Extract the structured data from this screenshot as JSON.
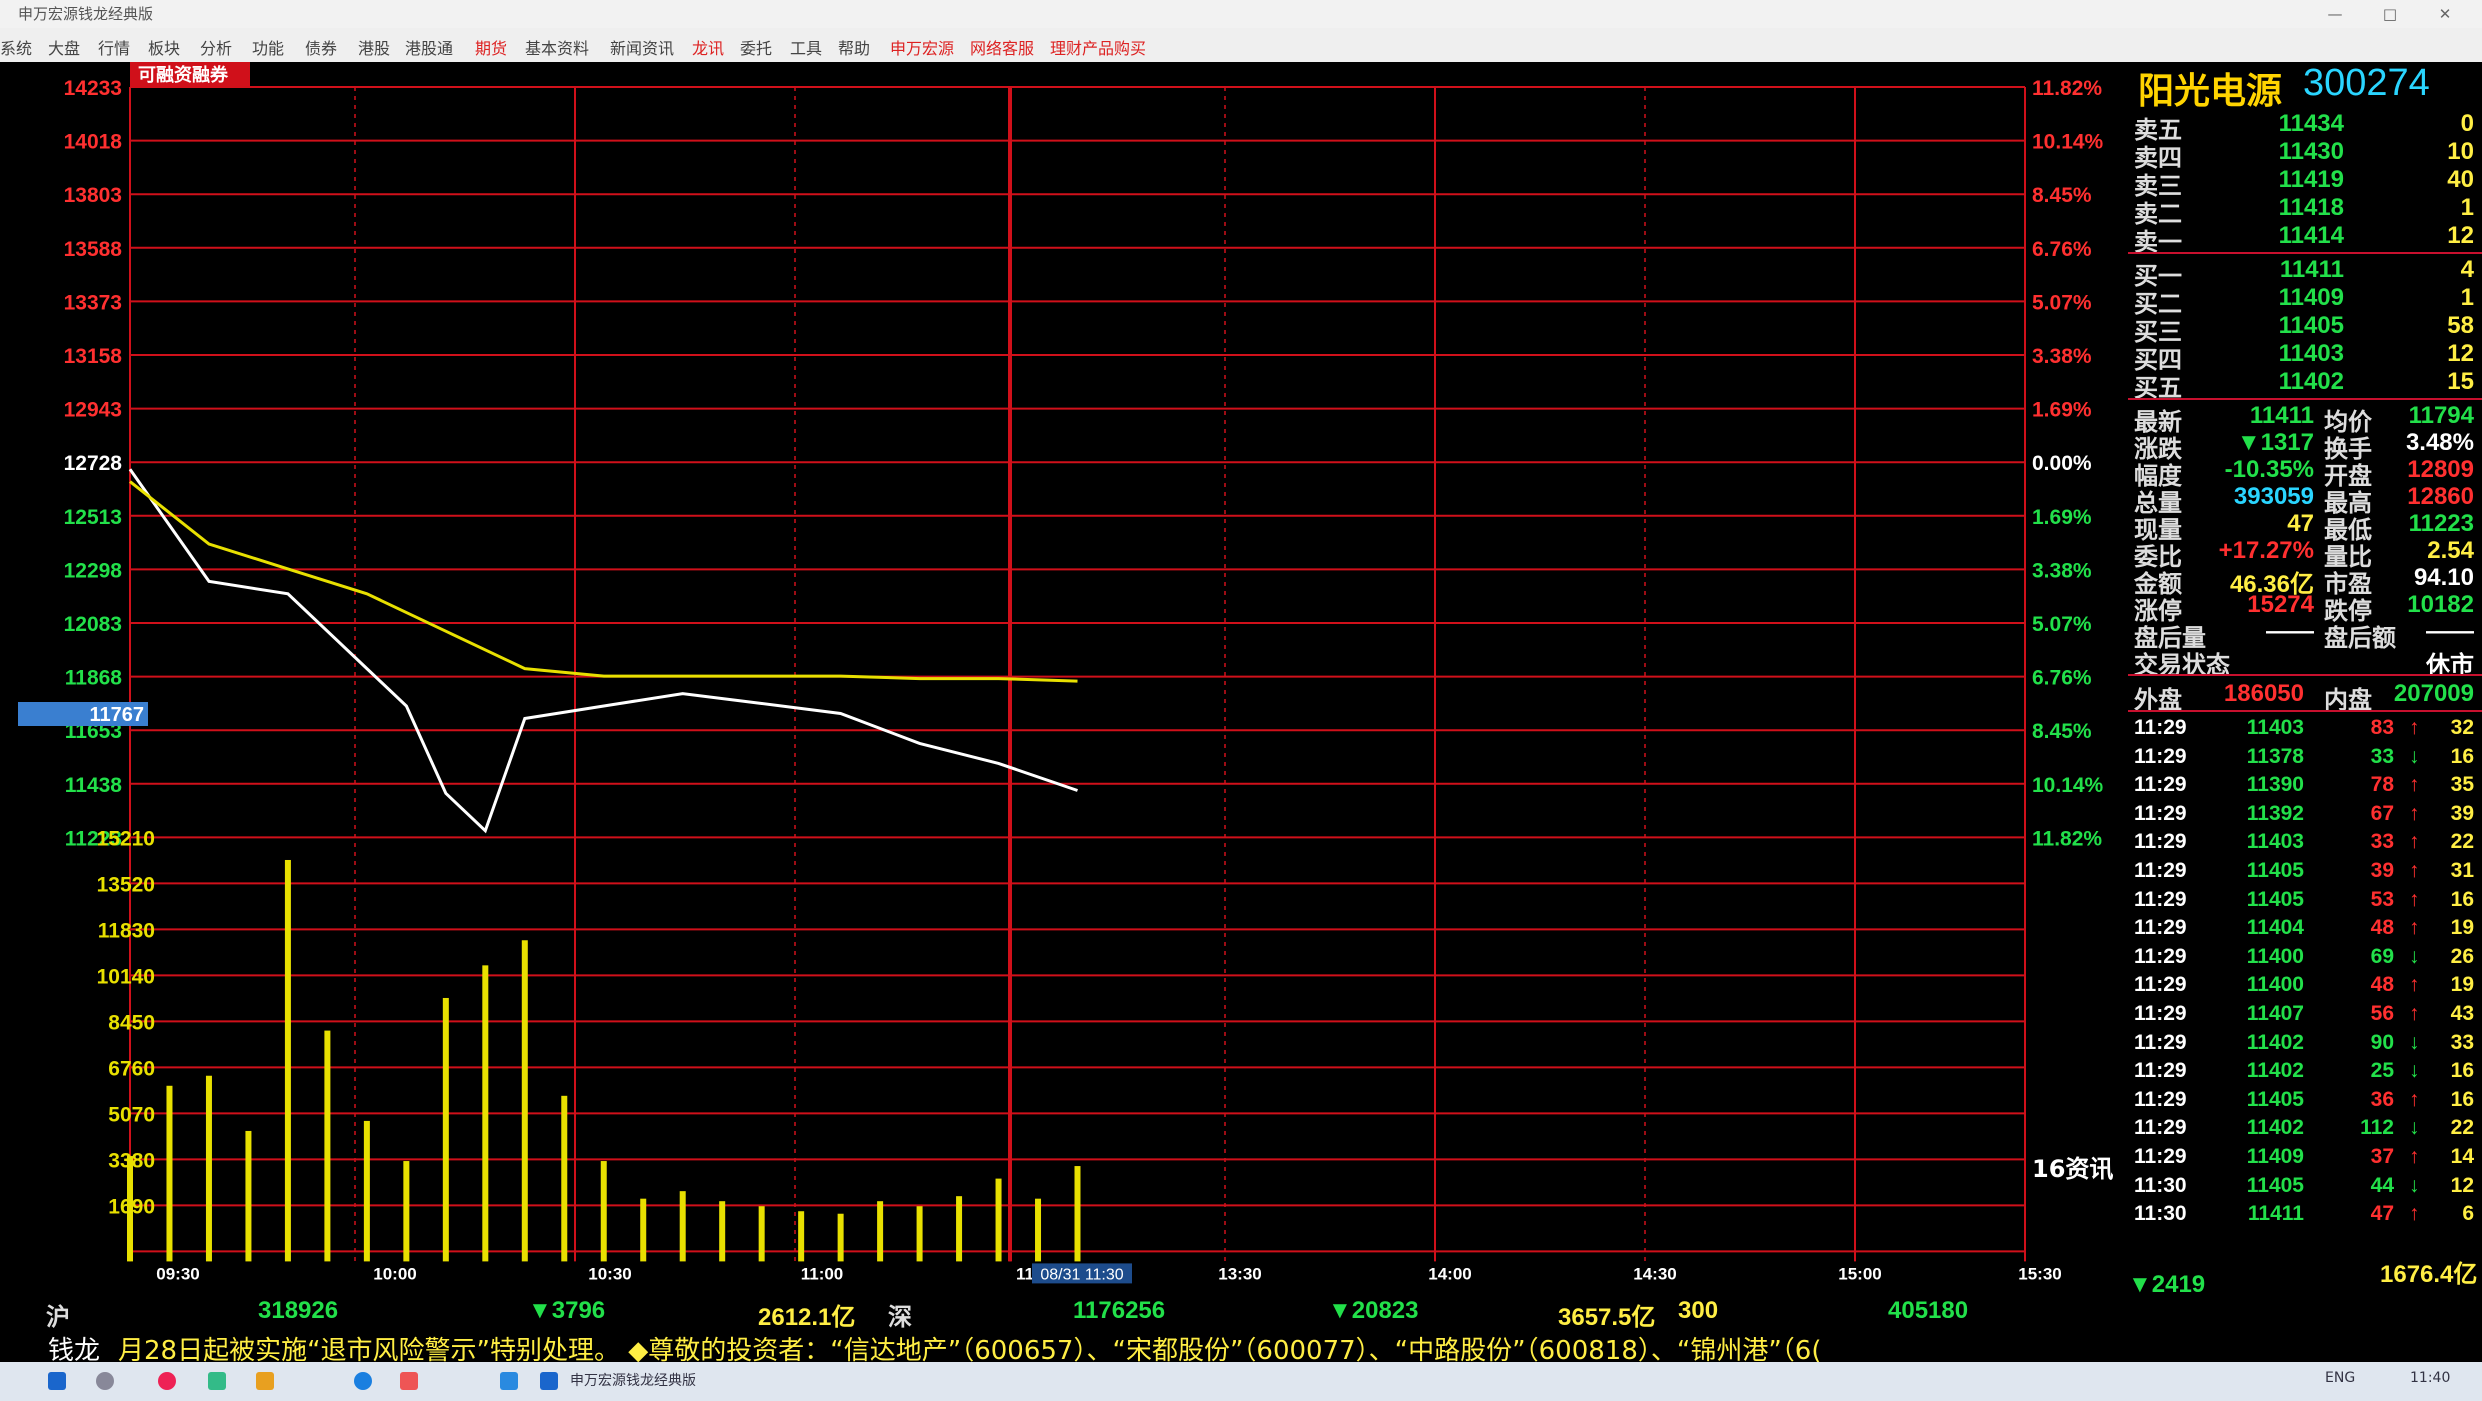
{
  "window": {
    "title": "申万宏源钱龙经典版",
    "controls": [
      "—",
      "□",
      "✕"
    ]
  },
  "menu": [
    {
      "label": "系统",
      "red": false
    },
    {
      "label": "大盘",
      "red": false
    },
    {
      "label": "行情",
      "red": false
    },
    {
      "label": "板块",
      "red": false
    },
    {
      "label": "分析",
      "red": false
    },
    {
      "label": "功能",
      "red": false
    },
    {
      "label": "债券",
      "red": false
    },
    {
      "label": "港股",
      "red": false
    },
    {
      "label": "港股通",
      "red": false
    },
    {
      "label": "期货",
      "red": true
    },
    {
      "label": "基本资料",
      "red": false
    },
    {
      "label": "新闻资讯",
      "red": false
    },
    {
      "label": "龙讯",
      "red": true
    },
    {
      "label": "委托",
      "red": false
    },
    {
      "label": "工具",
      "red": false
    },
    {
      "label": "帮助",
      "red": false
    },
    {
      "label": "申万宏源",
      "red": true
    },
    {
      "label": "网络客服",
      "red": true
    },
    {
      "label": "理财产品购买",
      "red": true
    }
  ],
  "chart": {
    "badge": "可融资融券",
    "price_labels": [
      "14233",
      "14018",
      "13803",
      "13588",
      "13373",
      "13158",
      "12943",
      "12728",
      "12513",
      "12298",
      "12083",
      "11868",
      "11653",
      "11438",
      "11223"
    ],
    "current_price_tag": "11767",
    "pct_labels": [
      "11.82%",
      "10.14%",
      "8.45%",
      "6.76%",
      "5.07%",
      "3.38%",
      "1.69%",
      "0.00%",
      "1.69%",
      "3.38%",
      "5.07%",
      "6.76%",
      "8.45%",
      "10.14%",
      "11.82%"
    ],
    "volume_labels": [
      "15210",
      "13520",
      "11830",
      "10140",
      "8450",
      "6760",
      "5070",
      "3380",
      "1690"
    ],
    "time_labels": [
      "09:30",
      "10:00",
      "10:30",
      "11:00",
      "11",
      "13:30",
      "14:00",
      "14:30",
      "15:00",
      "15:30"
    ],
    "cursor_time": "08/31 11:30",
    "news_label": "16资讯",
    "colors": {
      "grid": "#d0101a",
      "price": "#ffffff",
      "avg": "#e8e000",
      "volume": "#e8e000",
      "up": "#ff3030",
      "down": "#22e04a"
    }
  },
  "chart_data": {
    "type": "line",
    "xlabel": "",
    "ylabel": "",
    "ylim": [
      11223,
      14233
    ],
    "x_range": [
      "09:30",
      "15:00"
    ],
    "series": [
      {
        "x": [
          "09:30",
          "09:40",
          "09:50",
          "10:00",
          "10:05",
          "10:10",
          "10:15",
          "10:20",
          "10:30",
          "10:40",
          "10:50",
          "11:00",
          "11:10",
          "11:20",
          "11:30"
        ],
        "y": [
          12700,
          12250,
          12200,
          11900,
          11750,
          11400,
          11250,
          11700,
          11750,
          11800,
          11760,
          11720,
          11600,
          11520,
          11411
        ]
      },
      {
        "x": [
          "09:30",
          "09:40",
          "09:50",
          "10:00",
          "10:10",
          "10:20",
          "10:30",
          "10:40",
          "10:50",
          "11:00",
          "11:10",
          "11:20",
          "11:30"
        ],
        "y": [
          12650,
          12400,
          12300,
          12200,
          12050,
          11900,
          11870,
          11870,
          11870,
          11870,
          11860,
          11860,
          11850
        ]
      }
    ],
    "volume": {
      "ylim": [
        0,
        16900
      ],
      "x": [
        "09:30",
        "09:35",
        "09:40",
        "09:45",
        "09:50",
        "09:55",
        "10:00",
        "10:05",
        "10:10",
        "10:15",
        "10:20",
        "10:25",
        "10:30",
        "10:35",
        "10:40",
        "10:45",
        "10:50",
        "10:55",
        "11:00",
        "11:05",
        "11:10",
        "11:15",
        "11:20",
        "11:25",
        "11:30"
      ],
      "values": [
        4200,
        7000,
        7400,
        5200,
        16000,
        9200,
        5600,
        4000,
        10500,
        11800,
        12800,
        6600,
        4000,
        2500,
        2800,
        2400,
        2200,
        2000,
        1900,
        2400,
        2200,
        2600,
        3300,
        2500,
        3800
      ]
    }
  },
  "quote": {
    "name": "阳光电源",
    "code": "300274",
    "asks": [
      {
        "label": "卖五",
        "price": "11434",
        "qty": "0"
      },
      {
        "label": "卖四",
        "price": "11430",
        "qty": "10"
      },
      {
        "label": "卖三",
        "price": "11419",
        "qty": "40"
      },
      {
        "label": "卖二",
        "price": "11418",
        "qty": "1"
      },
      {
        "label": "卖一",
        "price": "11414",
        "qty": "12"
      }
    ],
    "bids": [
      {
        "label": "买一",
        "price": "11411",
        "qty": "4"
      },
      {
        "label": "买二",
        "price": "11409",
        "qty": "1"
      },
      {
        "label": "买三",
        "price": "11405",
        "qty": "58"
      },
      {
        "label": "买四",
        "price": "11403",
        "qty": "12"
      },
      {
        "label": "买五",
        "price": "11402",
        "qty": "15"
      }
    ],
    "stats": [
      {
        "l1": "最新",
        "v1": "11411",
        "c1": "#22e04a",
        "l2": "均价",
        "v2": "11794",
        "c2": "#22e04a"
      },
      {
        "l1": "涨跌",
        "v1": "▼1317",
        "c1": "#22e04a",
        "l2": "换手",
        "v2": "3.48%",
        "c2": "#ffffff"
      },
      {
        "l1": "幅度",
        "v1": "-10.35%",
        "c1": "#22e04a",
        "l2": "开盘",
        "v2": "12809",
        "c2": "#ff3030"
      },
      {
        "l1": "总量",
        "v1": "393059",
        "c1": "#2ad5ff",
        "l2": "最高",
        "v2": "12860",
        "c2": "#ff3030"
      },
      {
        "l1": "现量",
        "v1": "47",
        "c1": "#ffee44",
        "l2": "最低",
        "v2": "11223",
        "c2": "#22e04a"
      },
      {
        "l1": "委比",
        "v1": "+17.27%",
        "c1": "#ff3030",
        "l2": "量比",
        "v2": "2.54",
        "c2": "#ffee44"
      },
      {
        "l1": "金额",
        "v1": "46.36亿",
        "c1": "#ffee44",
        "l2": "市盈",
        "v2": "94.10",
        "c2": "#ffffff"
      },
      {
        "l1": "涨停",
        "v1": "15274",
        "c1": "#ff3030",
        "l2": "跌停",
        "v2": "10182",
        "c2": "#22e04a"
      },
      {
        "l1": "盘后量",
        "v1": "——",
        "c1": "#ffffff",
        "l2": "盘后额",
        "v2": "——",
        "c2": "#ffffff"
      },
      {
        "l1": "交易状态",
        "v1": "",
        "c1": "#ffffff",
        "l2": "",
        "v2": "休市",
        "c2": "#ffffff"
      }
    ],
    "outer_label": "外盘",
    "outer_value": "186050",
    "inner_label": "内盘",
    "inner_value": "207009",
    "ticks": [
      {
        "t": "11:29",
        "p": "11403",
        "v": "83",
        "d": "↑",
        "n": "32"
      },
      {
        "t": "11:29",
        "p": "11378",
        "v": "33",
        "d": "↓",
        "n": "16"
      },
      {
        "t": "11:29",
        "p": "11390",
        "v": "78",
        "d": "↑",
        "n": "35"
      },
      {
        "t": "11:29",
        "p": "11392",
        "v": "67",
        "d": "↑",
        "n": "39"
      },
      {
        "t": "11:29",
        "p": "11403",
        "v": "33",
        "d": "↑",
        "n": "22"
      },
      {
        "t": "11:29",
        "p": "11405",
        "v": "39",
        "d": "↑",
        "n": "31"
      },
      {
        "t": "11:29",
        "p": "11405",
        "v": "53",
        "d": "↑",
        "n": "16"
      },
      {
        "t": "11:29",
        "p": "11404",
        "v": "48",
        "d": "↑",
        "n": "19"
      },
      {
        "t": "11:29",
        "p": "11400",
        "v": "69",
        "d": "↓",
        "n": "26"
      },
      {
        "t": "11:29",
        "p": "11400",
        "v": "48",
        "d": "↑",
        "n": "19"
      },
      {
        "t": "11:29",
        "p": "11407",
        "v": "56",
        "d": "↑",
        "n": "43"
      },
      {
        "t": "11:29",
        "p": "11402",
        "v": "90",
        "d": "↓",
        "n": "33"
      },
      {
        "t": "11:29",
        "p": "11402",
        "v": "25",
        "d": "↓",
        "n": "16"
      },
      {
        "t": "11:29",
        "p": "11405",
        "v": "36",
        "d": "↑",
        "n": "16"
      },
      {
        "t": "11:29",
        "p": "11402",
        "v": "112",
        "d": "↓",
        "n": "22"
      },
      {
        "t": "11:29",
        "p": "11409",
        "v": "37",
        "d": "↑",
        "n": "14"
      },
      {
        "t": "11:30",
        "p": "11405",
        "v": "44",
        "d": "↓",
        "n": "12"
      },
      {
        "t": "11:30",
        "p": "11411",
        "v": "47",
        "d": "↑",
        "n": "6"
      }
    ]
  },
  "status": {
    "sh_label": "沪",
    "sh_index": "318926",
    "sh_change": "▼3796",
    "sh_amount": "2612.1亿",
    "sz_label": "深",
    "sz_index": "1176256",
    "sz_change": "▼20823",
    "sz_amount": "3657.5亿",
    "c300_label": "300",
    "c300_index": "405180",
    "c300_change": "▼2419",
    "c300_amount": "1676.4亿"
  },
  "ticker": {
    "brand": "钱龙",
    "text": "月28日起被实施“退市风险警示”特别处理。 ◆尊敬的投资者：“信达地产”（600657）、“宋都股份”（600077）、“中路股份”（600818）、“锦州港”（6("
  },
  "taskbar": {
    "app_label": "申万宏源钱龙经典版",
    "lang": "ENG",
    "clock": "11:40"
  }
}
